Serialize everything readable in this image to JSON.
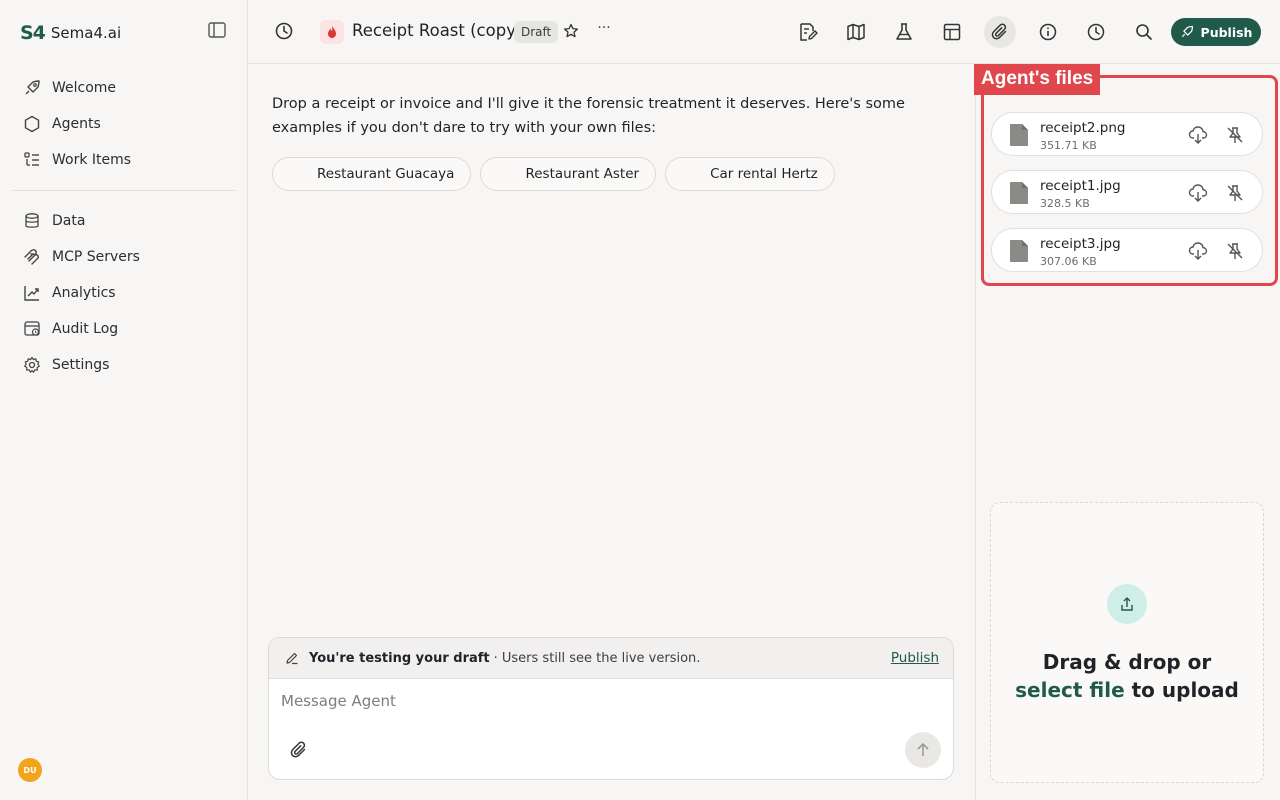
{
  "brand": {
    "mark": "S4",
    "name": "Sema4.ai"
  },
  "sidebar": {
    "items": [
      {
        "label": "Welcome",
        "icon": "rocket-icon"
      },
      {
        "label": "Agents",
        "icon": "hexagon-icon"
      },
      {
        "label": "Work Items",
        "icon": "list-icon"
      },
      {
        "label": "Data",
        "icon": "database-icon"
      },
      {
        "label": "MCP Servers",
        "icon": "mcp-icon"
      },
      {
        "label": "Analytics",
        "icon": "analytics-icon"
      },
      {
        "label": "Audit Log",
        "icon": "audit-icon"
      },
      {
        "label": "Settings",
        "icon": "gear-icon"
      }
    ],
    "user_initials": "DU"
  },
  "header": {
    "title": "Receipt Roast (copy)",
    "badge": "Draft",
    "more": "···",
    "publish_label": "Publish"
  },
  "main": {
    "intro": "Drop a receipt or invoice and I'll give it the forensic treatment it deserves. Here's some examples if you don't dare to try with your own files:",
    "chips": [
      "Restaurant Guacaya",
      "Restaurant Aster",
      "Car rental Hertz"
    ]
  },
  "composer": {
    "draft_bold": "You're testing your draft",
    "draft_rest": "· Users still see the live version.",
    "publish_link": "Publish",
    "placeholder": "Message Agent"
  },
  "files_panel": {
    "highlight_label": "Agent's files",
    "files": [
      {
        "name": "receipt2.png",
        "size": "351.71 KB"
      },
      {
        "name": "receipt1.jpg",
        "size": "328.5 KB"
      },
      {
        "name": "receipt3.jpg",
        "size": "307.06 KB"
      }
    ],
    "dropzone": {
      "line1": "Drag & drop or",
      "link": "select file",
      "line2_rest": " to upload"
    }
  },
  "colors": {
    "accent": "#1f5a4a",
    "highlight": "#e0474c",
    "upload_bg": "#cfeee8",
    "avatar": "#f2a41d"
  }
}
